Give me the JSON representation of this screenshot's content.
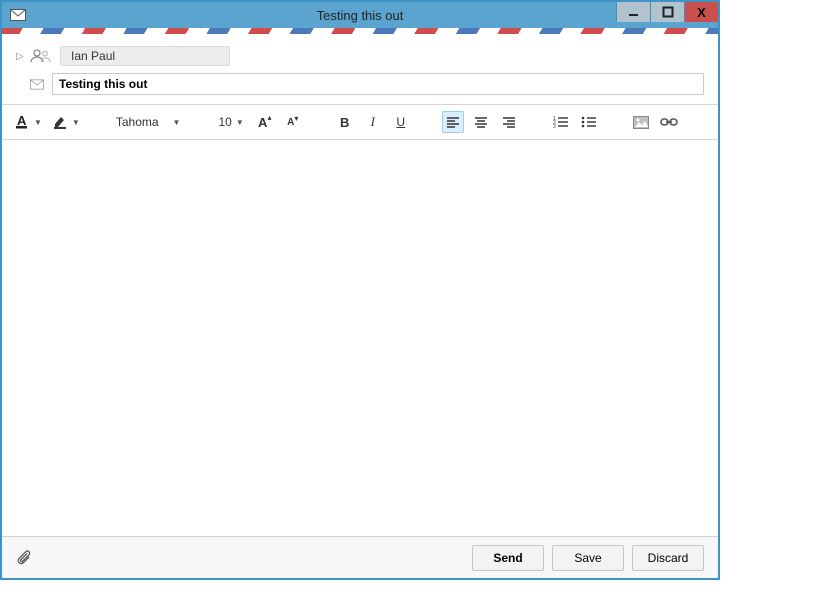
{
  "titlebar": {
    "title": "Testing this out"
  },
  "recipients": {
    "to": "Ian Paul"
  },
  "subject": {
    "value": "Testing this out"
  },
  "toolbar": {
    "font_name": "Tahoma",
    "font_size": "10"
  },
  "footer": {
    "send": "Send",
    "save": "Save",
    "discard": "Discard"
  }
}
